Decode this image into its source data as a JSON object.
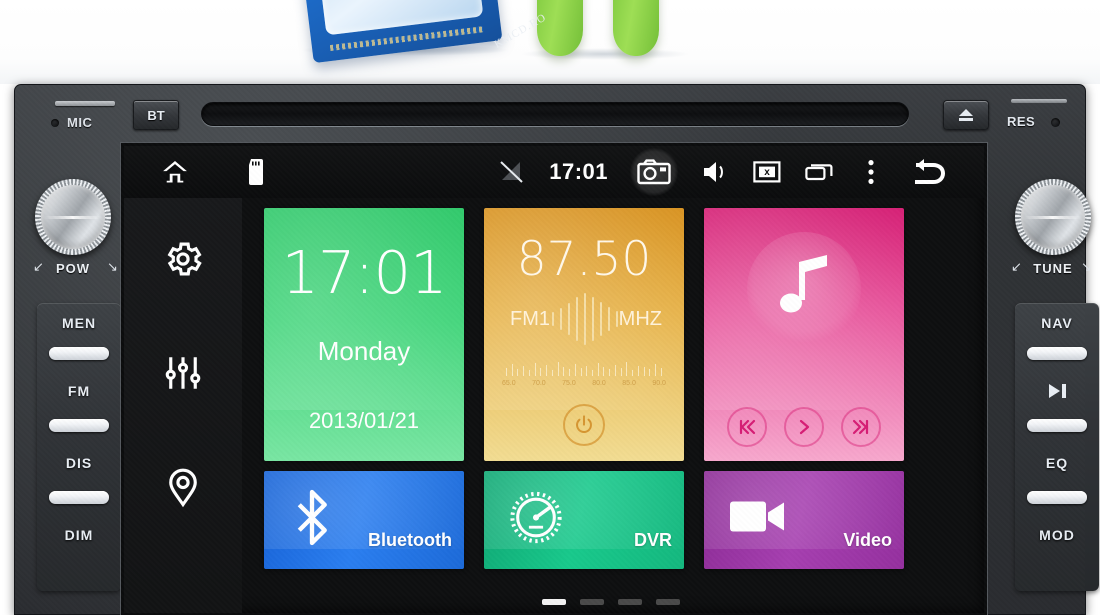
{
  "photo": {
    "watermark": "KMCD.RO",
    "pcb_label": "pcb-board",
    "droid_label": "android-robot-legs"
  },
  "unit": {
    "mic_label": "MIC",
    "bt_button": "BT",
    "res_label": "RES",
    "eject_label": "eject",
    "knob_left_label": "POW",
    "knob_right_label": "TUNE",
    "arc_left": "⤵",
    "arc_right": "⤴",
    "left_buttons": [
      "MEN",
      "FM",
      "DIS",
      "DIM"
    ],
    "right_buttons": [
      "NAV",
      "",
      "EQ",
      "MOD"
    ],
    "right_play_icon": "play-pause-icon"
  },
  "statusbar": {
    "time": "17:01",
    "icons_left": [
      "home-icon",
      "sd-card-icon"
    ],
    "icons_right": [
      "signal-off-icon",
      "camera-icon",
      "volume-icon",
      "screen-off-icon",
      "recents-icon",
      "overflow-menu-icon",
      "back-icon"
    ]
  },
  "rail": {
    "items": [
      {
        "icon": "settings-gear-icon",
        "name": "settings"
      },
      {
        "icon": "equalizer-icon",
        "name": "equalizer"
      },
      {
        "icon": "location-pin-icon",
        "name": "navigation"
      }
    ]
  },
  "tiles": {
    "clock": {
      "time": "17:01",
      "weekday": "Monday",
      "date": "2013/01/21",
      "color": "#43d67c"
    },
    "radio": {
      "frequency": "87.50",
      "band": "FM1",
      "unit": "MHZ",
      "scale_labels": [
        "65.0",
        "70.0",
        "75.0",
        "80.0",
        "85.0",
        "90.0"
      ],
      "power_icon": "power-icon",
      "color": "#e8b44b"
    },
    "music": {
      "icon": "music-note-icon",
      "prev_label": "previous-track",
      "play_label": "play",
      "next_label": "next-track",
      "color": "#e8539b"
    },
    "bluetooth": {
      "label": "Bluetooth",
      "icon": "bluetooth-icon",
      "color": "#2a7ef0"
    },
    "dvr": {
      "label": "DVR",
      "icon": "gauge-icon",
      "color": "#18c98c"
    },
    "video": {
      "label": "Video",
      "icon": "video-camera-icon",
      "color": "#a63fb0"
    }
  },
  "pager": {
    "count": 4,
    "active": 1
  }
}
